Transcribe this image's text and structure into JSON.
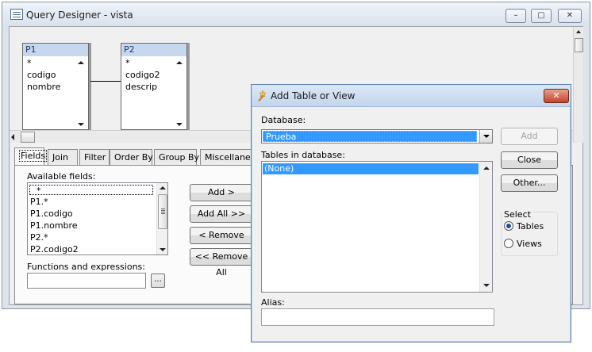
{
  "main_window": {
    "title": "Query Designer - vista",
    "min_icon": "–",
    "max_icon": "▢",
    "close_icon": "✕"
  },
  "diagram": {
    "tables": [
      {
        "name": "P1",
        "fields": [
          "*",
          "codigo",
          "nombre"
        ]
      },
      {
        "name": "P2",
        "fields": [
          "*",
          "codigo2",
          "descrip"
        ]
      }
    ]
  },
  "tabs": [
    "Fields",
    "Join",
    "Filter",
    "Order By",
    "Group By",
    "Miscellaneous"
  ],
  "fields_tab": {
    "available_label": "Available fields:",
    "available_fields": [
      "*",
      "P1.*",
      "P1.codigo",
      "P1.nombre",
      "P2.*",
      "P2.codigo2"
    ],
    "add_label": "Add >",
    "add_all_label": "Add All >>",
    "remove_label": "< Remove",
    "remove_all_label": "<< Remove All",
    "functions_label": "Functions and expressions:",
    "functions_value": "",
    "browse_label": "..."
  },
  "dialog": {
    "title": "Add Table or View",
    "close_icon": "✕",
    "database_label": "Database:",
    "database_value": "Prueba",
    "tables_label": "Tables in database:",
    "tables": [
      "(None)"
    ],
    "alias_label": "Alias:",
    "alias_value": "",
    "add_label": "Add",
    "close_label": "Close",
    "other_label": "Other...",
    "select_label": "Select",
    "select_options": [
      "Tables",
      "Views"
    ],
    "selected_option": "Tables"
  },
  "colors": {
    "selection": "#3399ff",
    "table_header": "#c7d8ee",
    "dialog_border": "#5a7fb3",
    "close_button": "#c4442a"
  }
}
